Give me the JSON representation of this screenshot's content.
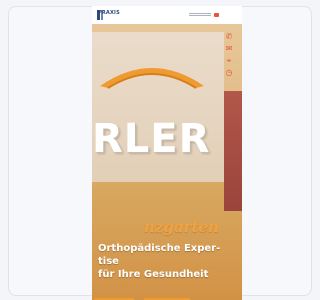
{
  "site": {
    "logo_text": "PRAXIS",
    "nav_accent_color": "#e2573a",
    "brand_orange": "#f19a2e"
  },
  "hero": {
    "sign_letters": "RLER",
    "script_line": "nzgarten",
    "headline_lines": [
      "Orthopädische Exper-",
      "tise",
      "für Ihre Gesundheit"
    ]
  },
  "side_icons": [
    {
      "icon": "phone-icon",
      "glyph": "✆"
    },
    {
      "icon": "mail-icon",
      "glyph": "✉"
    },
    {
      "icon": "location-icon",
      "glyph": "⌖"
    },
    {
      "icon": "clock-icon",
      "glyph": "◷"
    }
  ],
  "cta_buttons": [
    {
      "label": ""
    },
    {
      "label": ""
    }
  ]
}
